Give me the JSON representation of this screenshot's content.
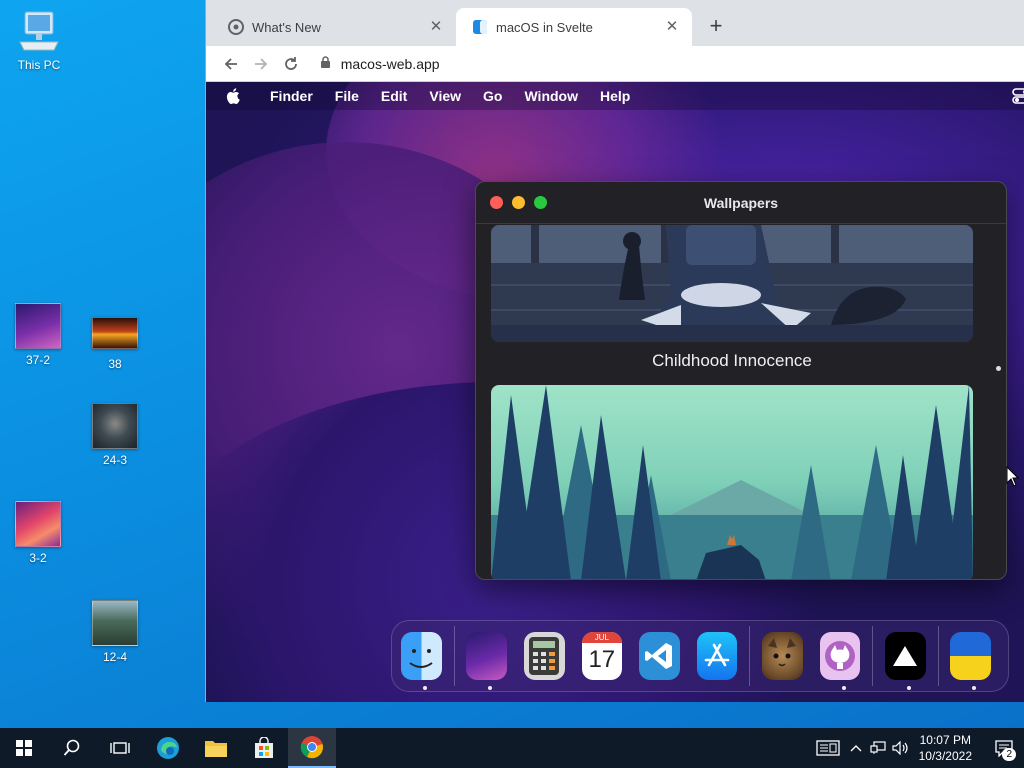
{
  "desktop": {
    "icons": [
      {
        "label": "This PC"
      },
      {
        "label": "37-2"
      },
      {
        "label": "38"
      },
      {
        "label": "24-3"
      },
      {
        "label": "3-2"
      },
      {
        "label": "12-4"
      }
    ]
  },
  "browser": {
    "tabs": [
      {
        "title": "What's New",
        "active": false
      },
      {
        "title": "macOS in Svelte",
        "active": true
      }
    ],
    "address": "macos-web.app"
  },
  "macos": {
    "menubar": {
      "app_name": "Finder",
      "menus": [
        "File",
        "Edit",
        "View",
        "Go",
        "Window",
        "Help"
      ]
    },
    "wallpapers_window": {
      "title": "Wallpapers",
      "items": [
        {
          "name": "Childhood Innocence"
        }
      ]
    },
    "dock": {
      "apps": [
        {
          "name": "finder-icon",
          "running": true
        },
        {
          "name": "wallpapers-icon",
          "running": true
        },
        {
          "name": "calculator-icon",
          "running": false
        },
        {
          "name": "calendar-icon",
          "running": false,
          "month": "JUL",
          "day": "17"
        },
        {
          "name": "vscode-icon",
          "running": false
        },
        {
          "name": "app-store-icon",
          "running": false
        },
        {
          "name": "cat-avatar-icon",
          "running": false
        },
        {
          "name": "github-icon",
          "running": true
        },
        {
          "name": "vercel-icon",
          "running": true
        },
        {
          "name": "ukraine-flag-icon",
          "running": true
        }
      ]
    }
  },
  "taskbar": {
    "time": "10:07 PM",
    "date": "10/3/2022",
    "notification_count": "2"
  },
  "colors": {
    "traffic_red": "#ff5f57",
    "traffic_yellow": "#febc2e",
    "traffic_green": "#28c840",
    "taskbar_bg": "#0f1a28"
  }
}
